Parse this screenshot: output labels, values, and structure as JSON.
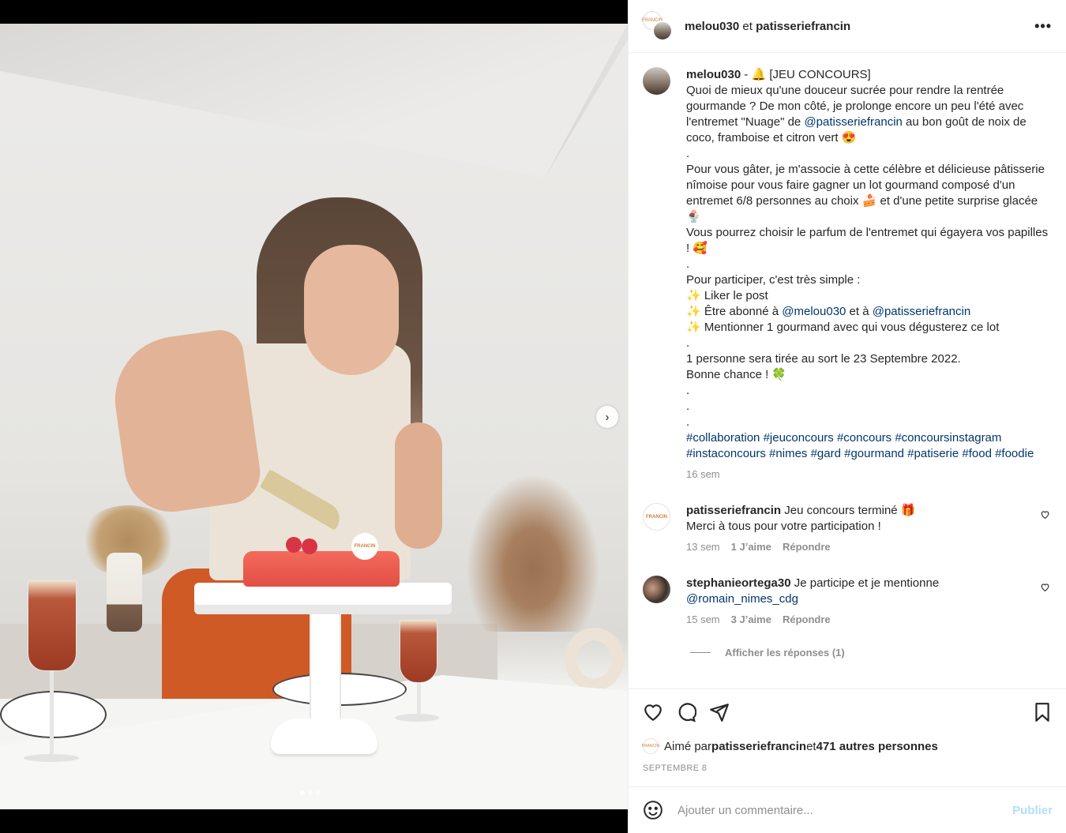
{
  "post": {
    "author": "melou030",
    "coauthor": "patisseriefrancin",
    "joiner": "et",
    "more_label": "•••",
    "carousel_next": "›"
  },
  "caption": {
    "username": "melou030",
    "p1": " - 🔔 [JEU CONCOURS]\nQuoi de mieux qu'une douceur sucrée pour rendre la rentrée gourmande ? De mon côté, je prolonge encore un peu l'été avec l'entremet \"Nuage\" de ",
    "mention1": "@patisseriefrancin",
    "p2": " au bon goût de noix de coco, framboise et citron vert 😍\n.\nPour vous gâter, je m'associe à cette célèbre et délicieuse pâtisserie nîmoise pour vous faire gagner un lot gourmand composé d'un entremet 6/8 personnes au choix 🍰 et d'une petite surprise glacée 🍨\nVous pourrez choisir le parfum de l'entremet qui égayera vos papilles ! 🥰\n.\nPour participer, c'est très simple :\n✨ Liker le post\n✨ Être abonné à ",
    "mention2": "@melou030",
    "p3": " et à ",
    "mention3": "@patisseriefrancin",
    "p4": "\n✨ Mentionner 1 gourmand avec qui vous dégusterez ce lot\n.\n1 personne sera tirée au sort le 23 Septembre 2022.\nBonne chance ! 🍀\n.\n.\n.\n",
    "hashtags": "#collaboration #jeuconcours #concours #concoursinstagram #instaconcours #nimes #gard #gourmand #patiserie #food #foodie",
    "time": "16 sem"
  },
  "comments": [
    {
      "username": "patisseriefrancin",
      "text": " Jeu concours terminé 🎁\nMerci à tous pour votre participation !",
      "time": "13 sem",
      "likes": "1 J’aime",
      "reply": "Répondre"
    },
    {
      "username": "stephanieortega30",
      "text": " Je participe et je mentionne ",
      "mention": "@romain_nimes_cdg",
      "time": "15 sem",
      "likes": "3 J’aime",
      "reply": "Répondre"
    }
  ],
  "view_replies": "Afficher les réponses (1)",
  "likes_line": {
    "prefix": "Aimé par ",
    "user": "patisseriefrancin",
    "mid": " et ",
    "count": "471 autres personnes"
  },
  "post_date": "SEPTEMBRE 8",
  "comment_box": {
    "placeholder": "Ajouter un commentaire...",
    "publish": "Publier"
  },
  "logo_text": "FRANCIN",
  "colors": {
    "link": "#00376b",
    "muted": "#8e8e8e",
    "publish_disabled": "#b2dffc"
  }
}
